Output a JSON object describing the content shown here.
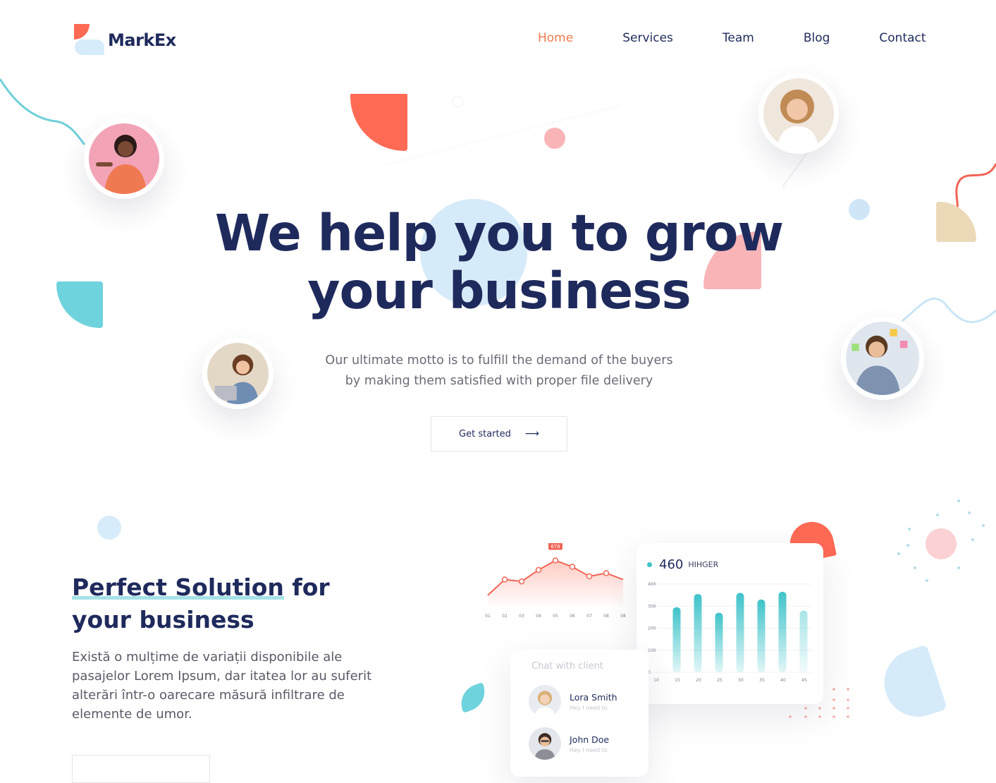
{
  "brand": {
    "name": "MarkEx"
  },
  "nav": {
    "items": [
      {
        "label": "Home",
        "active": true
      },
      {
        "label": "Services",
        "active": false
      },
      {
        "label": "Team",
        "active": false
      },
      {
        "label": "Blog",
        "active": false
      },
      {
        "label": "Contact",
        "active": false
      }
    ]
  },
  "hero": {
    "title_line1": "We help you to grow",
    "title_line2": "your business",
    "subtitle_line1": "Our ultimate motto is to fulfill the demand of the buyers",
    "subtitle_line2": "by making them satisfied with proper file delivery",
    "cta_label": "Get started",
    "cta_icon": "arrow-right-icon"
  },
  "section": {
    "title_highlight": "Perfect Solution",
    "title_rest": " for",
    "title_line2": "your business",
    "body": "Există o mulțime de variații disponibile ale pasajelor Lorem Ipsum, dar itatea lor au suferit alterări într-o oarecare măsură  infiltrare de elemente de umor."
  },
  "dashboard": {
    "line_chart": {
      "badge": "678",
      "x_labels": [
        "01",
        "02",
        "03",
        "04",
        "05",
        "06",
        "07",
        "08",
        "08"
      ],
      "values": [
        20,
        45,
        42,
        60,
        75,
        65,
        50,
        55,
        45
      ]
    },
    "bar_chart": {
      "value": "460",
      "label": "HIHGER",
      "y_ticks": [
        "400",
        "300",
        "200",
        "100",
        "0"
      ],
      "x_labels": [
        "10",
        "15",
        "20",
        "25",
        "30",
        "35",
        "40",
        "45"
      ],
      "values": [
        295,
        355,
        270,
        360,
        330,
        365,
        280
      ],
      "y_max": 400,
      "accent": "#3ec3c9"
    },
    "chat": {
      "title": "Chat with client",
      "contacts": [
        {
          "name": "Lora Smith",
          "message": "Hey I need to"
        },
        {
          "name": "John Doe",
          "message": "Hey I need to"
        }
      ]
    }
  },
  "colors": {
    "navy": "#1f2a5c",
    "coral": "#ff6a55",
    "teal": "#6fd3dd",
    "light_blue": "#d7ecfa",
    "pink": "#f9b4b8",
    "sand": "#ecd9b8",
    "nav_active": "#f07a4c"
  }
}
